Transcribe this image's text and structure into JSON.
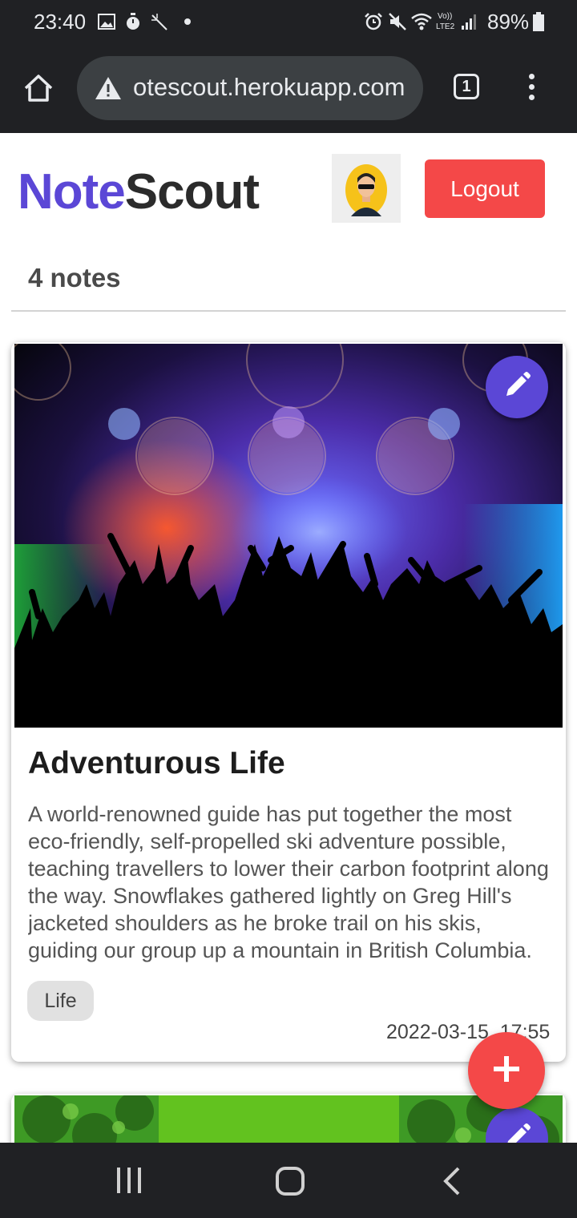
{
  "status_bar": {
    "time": "23:40",
    "battery_percent": "89%",
    "icons": [
      "image-icon",
      "timer-icon",
      "magic-wand-icon",
      "dot-icon",
      "alarm-icon",
      "mute-icon",
      "wifi-icon",
      "volte-icon",
      "signal-icon",
      "battery-icon"
    ]
  },
  "browser": {
    "url": "otescout.herokuapp.com",
    "tab_count": "1",
    "icons": [
      "home-icon",
      "warning-icon",
      "tabs-icon",
      "more-vert-icon"
    ]
  },
  "app": {
    "brand_part1": "Note",
    "brand_part2": "Scout",
    "logout_label": "Logout",
    "notes_count": "4 notes",
    "brand_color": "#5b47d6",
    "logout_color": "#f44848"
  },
  "notes": [
    {
      "title": "Adventurous Life",
      "body": "A world-renowned guide has put together the most eco-friendly, self-propelled ski adventure possible, teaching travellers to lower their carbon footprint along the way. Snowflakes gathered lightly on Greg Hill's jacketed shoulders as he broke trail on his skis, guiding our group up a mountain in British Columbia.",
      "tag": "Life",
      "date": "2022-03-15, 17:55",
      "image": "concert-crowd-image"
    },
    {
      "image": "green-foliage-image"
    }
  ],
  "nav_bar": {
    "icons": [
      "recent-apps-icon",
      "home-button-icon",
      "back-icon"
    ]
  }
}
